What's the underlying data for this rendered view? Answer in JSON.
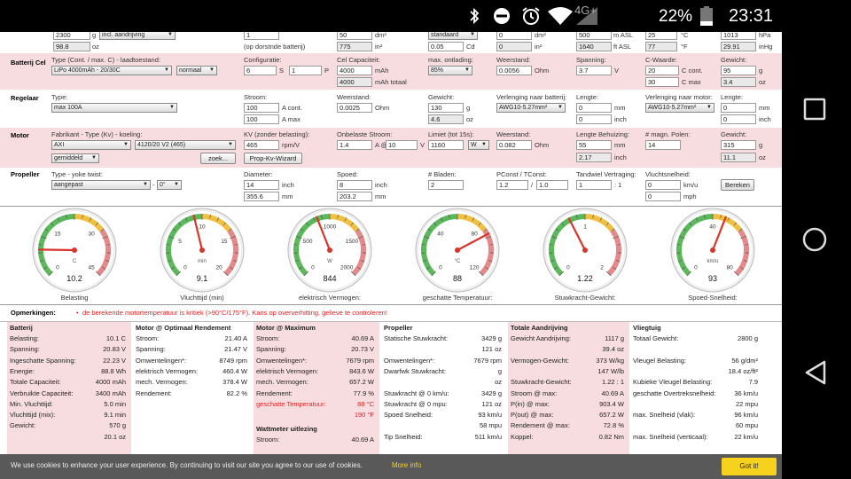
{
  "statusbar": {
    "network": "4G+",
    "battery": "22%",
    "time": "23:31"
  },
  "top_partial": {
    "r1": [
      "2300",
      "incl. aandrijving",
      "1",
      "50",
      "standaard",
      "0",
      "500",
      "25",
      "1013"
    ],
    "r1_units": [
      "g",
      "dm²",
      "dm²",
      "m ASL",
      "°C",
      "hPa"
    ],
    "r2": [
      "98.8",
      "(op dorstnde batterij)",
      "775",
      "0.05",
      "0",
      "1640",
      "77",
      "29.91"
    ],
    "r2_units": [
      "oz",
      "in²",
      "Cd",
      "in²",
      "ft ASL",
      "°F",
      "inHg"
    ]
  },
  "battery": {
    "title": "Batterij Cel",
    "type_label": "Type (Cont. / max. C) - laadtoestand:",
    "type_value": "LiPo 4000mAh - 20/30C",
    "charge_value": "normaal",
    "config_label": "Configuratie:",
    "config_s": "6",
    "config_s_unit": "S",
    "config_p": "1",
    "config_p_unit": "P",
    "cap_label": "Cel Capaciteit:",
    "cap_value": "4000",
    "cap_unit": "mAh",
    "cap_total": "4000",
    "cap_total_unit": "mAh totaal",
    "discharge_label": "max. ontlading:",
    "discharge_value": "85%",
    "res_label": "Weerstand:",
    "res_value": "0.0056",
    "res_unit": "Ohm",
    "volt_label": "Spanning:",
    "volt_value": "3.7",
    "volt_unit": "V",
    "crate_label": "C-Waarde:",
    "crate_cont": "20",
    "crate_cont_unit": "C cont.",
    "crate_max": "30",
    "crate_max_unit": "C max",
    "weight_label": "Gewicht:",
    "weight_g": "95",
    "weight_g_unit": "g",
    "weight_oz": "3.4",
    "weight_oz_unit": "oz"
  },
  "controller": {
    "title": "Regelaar",
    "type_label": "Type:",
    "type_value": "max 100A",
    "current_label": "Stroom:",
    "current_cont": "100",
    "current_cont_unit": "A cont.",
    "current_max": "100",
    "current_max_unit": "A max",
    "res_label": "Weerstand:",
    "res_value": "0.0025",
    "res_unit": "Ohm",
    "weight_label": "Gewicht:",
    "weight_g": "130",
    "weight_g_unit": "g",
    "weight_oz": "4.6",
    "weight_oz_unit": "oz",
    "ext_batt_label": "Verlenging naar batterij:",
    "ext_batt_value": "AWG10-5.27mm²",
    "len1_label": "Lengte:",
    "len1_mm": "0",
    "len1_mm_unit": "mm",
    "len1_in": "0",
    "len1_in_unit": "inch",
    "ext_motor_label": "Verlenging naar motor:",
    "ext_motor_value": "AWG10-5.27mm²",
    "len2_label": "Lengte:",
    "len2_mm": "0",
    "len2_mm_unit": "mm",
    "len2_in": "0",
    "len2_in_unit": "inch"
  },
  "motor": {
    "title": "Motor",
    "type_label": "Fabrikant - Type (Kv) - koeling:",
    "maker": "AXI",
    "model": "4120/20 V2 (465)",
    "cooling": "gemiddeld",
    "search_btn": "zoek...",
    "kv_label": "KV (zonder belasting):",
    "kv_value": "465",
    "kv_unit": "rpm/V",
    "kv_btn": "Prop-Kv-Wizard",
    "noload_label": "Onbelaste Stroom:",
    "noload_a": "1.4",
    "noload_a_unit": "A @",
    "noload_v": "10",
    "noload_v_unit": "V",
    "limit_label": "Limiet (tot 15s):",
    "limit_value": "1160",
    "limit_unit": "W",
    "res_label": "Weerstand:",
    "res_value": "0.082",
    "res_unit": "Ohm",
    "case_label": "Lengte Behuizing:",
    "case_mm": "55",
    "case_mm_unit": "mm",
    "case_in": "2.17",
    "case_in_unit": "inch",
    "poles_label": "# magn. Polen:",
    "poles_value": "14",
    "weight_label": "Gewicht:",
    "weight_g": "315",
    "weight_g_unit": "g",
    "weight_oz": "11.1",
    "weight_oz_unit": "oz"
  },
  "propeller": {
    "title": "Propeller",
    "type_label": "Type - yoke twist:",
    "type_value": "aangepast",
    "twist_value": "0°",
    "diam_label": "Diameter:",
    "diam_in": "14",
    "diam_in_unit": "inch",
    "diam_mm": "355.6",
    "diam_mm_unit": "mm",
    "pitch_label": "Spoed:",
    "pitch_in": "8",
    "pitch_in_unit": "inch",
    "pitch_mm": "203.2",
    "pitch_mm_unit": "mm",
    "blades_label": "# Bladen:",
    "blades_value": "2",
    "pconst_label": "PConst / TConst:",
    "pconst_value": "1.2",
    "pconst_sep": "/",
    "tconst_value": "1.0",
    "gear_label": "Tandwiel Vertraging:",
    "gear_value": "1",
    "gear_sep": ": 1",
    "speed_label": "Vluchtsnelheid:",
    "speed_kmh": "0",
    "speed_kmh_unit": "km/u",
    "speed_mph": "0",
    "speed_mph_unit": "mph",
    "calc_btn": "Bereken"
  },
  "gauges": [
    {
      "value": "10.2",
      "caption": "Belasting",
      "unit": "C",
      "ticks": [
        "0",
        "15",
        "30",
        "45"
      ],
      "frac": 0.17
    },
    {
      "value": "9.1",
      "caption": "Vluchttijd (min)",
      "unit": "min",
      "ticks": [
        "0",
        "5",
        "10",
        "15",
        "20"
      ],
      "frac": 0.45
    },
    {
      "value": "844",
      "caption": "elektrisch Vermogen:",
      "unit": "W",
      "ticks": [
        "0",
        "500",
        "1000",
        "1500",
        "2000"
      ],
      "frac": 0.42
    },
    {
      "value": "88",
      "caption": "geschatte Temperatuur:",
      "unit": "°C",
      "ticks": [
        "0",
        "40",
        "80",
        "120"
      ],
      "frac": 0.73
    },
    {
      "value": "1.22",
      "caption": "Stuwkracht-Gewicht:",
      "unit": "",
      "ticks": [
        "0",
        "1",
        "2"
      ],
      "frac": 0.4
    },
    {
      "value": "93",
      "caption": "Spoed-Snelheid:",
      "unit": "km/u",
      "ticks": [
        "0",
        "40",
        "80"
      ],
      "frac": 0.58
    }
  ],
  "remarks": {
    "label": "Opmerkingen:",
    "text": "de berekende motortemperatuur is kritiek (>90°C/175°F). Kans op oververhitting, gelieve te controleren!"
  },
  "results": [
    {
      "title": "Batterij",
      "rows": [
        [
          "Belasting:",
          "10.1 C"
        ],
        [
          "Spanning:",
          "20.83 V"
        ],
        [
          "Ingeschatte Spanning:",
          "22.23 V"
        ],
        [
          "Energie:",
          "88.8 Wh"
        ],
        [
          "Totale Capaciteit:",
          "4000 mAh"
        ],
        [
          "Verbruikte Capaciteit:",
          "3400 mAh"
        ],
        [
          "Min. Vluchttijd:",
          "5.0 min"
        ],
        [
          "Vluchttijd (mix):",
          "9.1 min"
        ],
        [
          "Gewicht:",
          "570 g"
        ],
        [
          "",
          "20.1 oz"
        ]
      ]
    },
    {
      "title": "Motor @ Optimaal Rendement",
      "rows": [
        [
          "Stroom:",
          "21.40 A"
        ],
        [
          "Spanning:",
          "21.47 V"
        ],
        [
          "Omwentelingen*:",
          "8749 rpm"
        ],
        [
          "elektrisch Vermogen:",
          "460.4 W"
        ],
        [
          "mech. Vermogen:",
          "378.4 W"
        ],
        [
          "Rendement:",
          "82.2 %"
        ]
      ]
    },
    {
      "title": "Motor @ Maximum",
      "rows": [
        [
          "Stroom:",
          "40.69 A"
        ],
        [
          "Spanning:",
          "20.73 V"
        ],
        [
          "Omwentelingen*:",
          "7679 rpm"
        ],
        [
          "elektrisch Vermogen:",
          "843.6 W"
        ],
        [
          "mech. Vermogen:",
          "657.2 W"
        ],
        [
          "Rendement:",
          "77.9 %"
        ],
        [
          "geschatte Temperatuur:",
          "88 °C"
        ],
        [
          "",
          "190 °F"
        ]
      ],
      "red_from": 6,
      "sub_title": "Wattmeter uitlezing",
      "sub_rows": [
        [
          "Stroom:",
          "40.69 A"
        ]
      ]
    },
    {
      "title": "Propeller",
      "rows": [
        [
          "Statische Stuwkracht:",
          "3429 g"
        ],
        [
          "",
          "121 oz"
        ],
        [
          "Omwentelingen*:",
          "7679 rpm"
        ],
        [
          "Dwarfwk Stuwkracht:",
          "g"
        ],
        [
          "",
          "oz"
        ],
        [
          "Stuwkracht @ 0 km/u:",
          "3429 g"
        ],
        [
          "Stuwkracht @ 0 mpu:",
          "121 oz"
        ],
        [
          "Spoed Snelheid:",
          "93 km/u"
        ],
        [
          "",
          "58 mpu"
        ],
        [
          "Tip Snelheid:",
          "511 km/u"
        ]
      ]
    },
    {
      "title": "Totale Aandrijving",
      "rows": [
        [
          "Gewicht Aandrijving:",
          "1117 g"
        ],
        [
          "",
          "39.4 oz"
        ],
        [
          "Vermogen-Gewicht:",
          "373 W/kg"
        ],
        [
          "",
          "147 W/lb"
        ],
        [
          "Stuwkracht-Gewicht:",
          "1.22 : 1"
        ],
        [
          "Stroom @ max:",
          "40.69 A"
        ],
        [
          "P(in) @ max:",
          "903.4 W"
        ],
        [
          "P(out) @ max:",
          "657.2 W"
        ],
        [
          "Rendement @ max:",
          "72.8 %"
        ],
        [
          "Koppel:",
          "0.82 Nm"
        ]
      ]
    },
    {
      "title": "Vliegtuig",
      "rows": [
        [
          "Totaal Gewicht:",
          "2800 g"
        ],
        [
          "",
          ""
        ],
        [
          "Vleugel Belasting:",
          "56 g/dm²"
        ],
        [
          "",
          "18.4 oz/ft²"
        ],
        [
          "Kubieke Vleugel Belasting:",
          "7.9"
        ],
        [
          "geschatte Overtreksnelheid:",
          "36 km/u"
        ],
        [
          "",
          "22 mpu"
        ],
        [
          "max. Snelheid (vlak):",
          "96 km/u"
        ],
        [
          "",
          "60 mpu"
        ],
        [
          "max. Snelheid (verticaal):",
          "22 km/u"
        ]
      ]
    }
  ],
  "cookie": {
    "text": "We use cookies to enhance your user experience. By continuing to visit our site you agree to our use of cookies.",
    "link": "More info",
    "button": "Got it!"
  },
  "colors": {
    "pink": "#f8dde0",
    "cookie_bg": "#595959",
    "cookie_btn": "#f6d21e",
    "link": "#f6d21e"
  }
}
